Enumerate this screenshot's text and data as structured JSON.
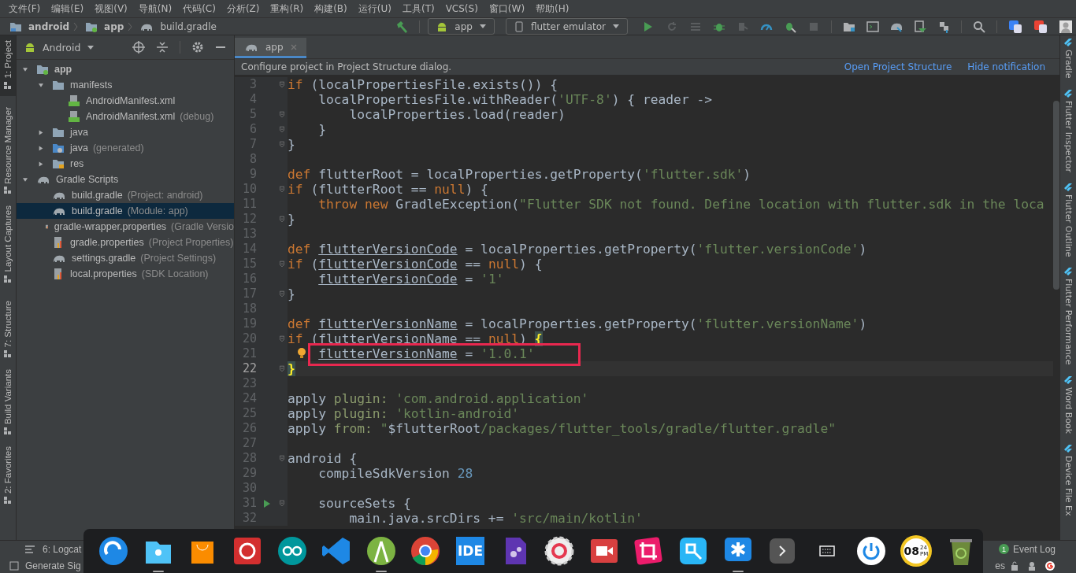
{
  "menu": [
    "文件(F)",
    "编辑(E)",
    "视图(V)",
    "导航(N)",
    "代码(C)",
    "分析(Z)",
    "重构(R)",
    "构建(B)",
    "运行(U)",
    "工具(T)",
    "VCS(S)",
    "窗口(W)",
    "帮助(H)"
  ],
  "breadcrumb": [
    {
      "label": "android",
      "kind": "project"
    },
    {
      "label": "app",
      "kind": "module"
    },
    {
      "label": "build.gradle",
      "kind": "gradle"
    }
  ],
  "toolbar": {
    "run_config": "app",
    "device": "flutter emulator"
  },
  "left_stripe": [
    {
      "label": "1: Project",
      "selected": true
    },
    {
      "label": "Resource Manager",
      "selected": false
    },
    {
      "label": "Layout Captures",
      "selected": false
    },
    {
      "label": "7: Structure",
      "selected": false
    },
    {
      "label": "Build Variants",
      "selected": false
    },
    {
      "label": "2: Favorites",
      "selected": false
    }
  ],
  "project": {
    "view": "Android",
    "tree": [
      {
        "label": "app",
        "kind": "module",
        "expanded": true,
        "selected": false,
        "children": [
          {
            "label": "manifests",
            "kind": "folder",
            "expanded": true,
            "selected": false,
            "children": [
              {
                "label": "AndroidManifest.xml",
                "kind": "manifest",
                "selected": false
              },
              {
                "label": "AndroidManifest.xml",
                "hint": "(debug)",
                "kind": "manifest",
                "selected": false
              }
            ]
          },
          {
            "label": "java",
            "kind": "folder",
            "expanded": false,
            "selected": false
          },
          {
            "label": "java",
            "hint": "(generated)",
            "kind": "genfolder",
            "expanded": false,
            "selected": false
          },
          {
            "label": "res",
            "kind": "resfolder",
            "expanded": false,
            "selected": false
          }
        ]
      },
      {
        "label": "Gradle Scripts",
        "kind": "gradle",
        "expanded": true,
        "selected": false,
        "children": [
          {
            "label": "build.gradle",
            "hint": "(Project: android)",
            "kind": "gradle",
            "selected": false
          },
          {
            "label": "build.gradle",
            "hint": "(Module: app)",
            "kind": "gradle",
            "selected": true
          },
          {
            "label": "gradle-wrapper.properties",
            "hint": "(Gradle Versio",
            "kind": "props",
            "selected": false
          },
          {
            "label": "gradle.properties",
            "hint": "(Project Properties)",
            "kind": "props",
            "selected": false
          },
          {
            "label": "settings.gradle",
            "hint": "(Project Settings)",
            "kind": "gradle",
            "selected": false
          },
          {
            "label": "local.properties",
            "hint": "(SDK Location)",
            "kind": "props",
            "selected": false
          }
        ]
      }
    ]
  },
  "editor_tabs": [
    {
      "label": "app",
      "selected": true
    }
  ],
  "notification": {
    "text": "Configure project in Project Structure dialog.",
    "links": [
      "Open Project Structure",
      "Hide notification"
    ]
  },
  "code": [
    {
      "number": "3",
      "fold": true,
      "current": false,
      "boxed": false,
      "lightbulb": false,
      "runnable": false,
      "tokens": [
        {
          "kind": "kw",
          "text": "if"
        },
        {
          "kind": "plain",
          "text": " (localPropertiesFile.exists()) {"
        }
      ]
    },
    {
      "number": "4",
      "fold": false,
      "current": false,
      "boxed": false,
      "lightbulb": false,
      "runnable": false,
      "tokens": [
        {
          "kind": "plain",
          "text": "    localPropertiesFile.withReader("
        },
        {
          "kind": "str",
          "text": "'UTF-8'"
        },
        {
          "kind": "plain",
          "text": ") { reader ->"
        }
      ]
    },
    {
      "number": "5",
      "fold": true,
      "current": false,
      "boxed": false,
      "lightbulb": false,
      "runnable": false,
      "tokens": [
        {
          "kind": "plain",
          "text": "        localProperties.load(reader)"
        }
      ]
    },
    {
      "number": "6",
      "fold": true,
      "current": false,
      "boxed": false,
      "lightbulb": false,
      "runnable": false,
      "tokens": [
        {
          "kind": "plain",
          "text": "    }"
        }
      ]
    },
    {
      "number": "7",
      "fold": true,
      "current": false,
      "boxed": false,
      "lightbulb": false,
      "runnable": false,
      "tokens": [
        {
          "kind": "plain",
          "text": "}"
        }
      ]
    },
    {
      "number": "8",
      "fold": false,
      "current": false,
      "boxed": false,
      "lightbulb": false,
      "runnable": false
    },
    {
      "number": "9",
      "fold": false,
      "current": false,
      "boxed": false,
      "lightbulb": false,
      "runnable": false,
      "tokens": [
        {
          "kind": "kw",
          "text": "def"
        },
        {
          "kind": "plain",
          "text": " flutterRoot = localProperties.getProperty("
        },
        {
          "kind": "str",
          "text": "'flutter.sdk'"
        },
        {
          "kind": "plain",
          "text": ")"
        }
      ]
    },
    {
      "number": "10",
      "fold": true,
      "current": false,
      "boxed": false,
      "lightbulb": false,
      "runnable": false,
      "tokens": [
        {
          "kind": "kw",
          "text": "if"
        },
        {
          "kind": "plain",
          "text": " (flutterRoot == "
        },
        {
          "kind": "kw",
          "text": "null"
        },
        {
          "kind": "plain",
          "text": ") {"
        }
      ]
    },
    {
      "number": "11",
      "fold": false,
      "current": false,
      "boxed": false,
      "lightbulb": false,
      "runnable": false,
      "tokens": [
        {
          "kind": "kw",
          "text": "    throw new"
        },
        {
          "kind": "plain",
          "text": " GradleException("
        },
        {
          "kind": "str",
          "text": "\"Flutter SDK not found. Define location with flutter.sdk in the loca"
        }
      ]
    },
    {
      "number": "12",
      "fold": true,
      "current": false,
      "boxed": false,
      "lightbulb": false,
      "runnable": false,
      "tokens": [
        {
          "kind": "plain",
          "text": "}"
        }
      ]
    },
    {
      "number": "13",
      "fold": false,
      "current": false,
      "boxed": false,
      "lightbulb": false,
      "runnable": false
    },
    {
      "number": "14",
      "fold": false,
      "current": false,
      "boxed": false,
      "lightbulb": false,
      "runnable": false,
      "tokens": [
        {
          "kind": "kw",
          "text": "def "
        },
        {
          "kind": "under",
          "text": "flutterVersionCode"
        },
        {
          "kind": "plain",
          "text": " = localProperties.getProperty("
        },
        {
          "kind": "str",
          "text": "'flutter.versionCode'"
        },
        {
          "kind": "plain",
          "text": ")"
        }
      ]
    },
    {
      "number": "15",
      "fold": true,
      "current": false,
      "boxed": false,
      "lightbulb": false,
      "runnable": false,
      "tokens": [
        {
          "kind": "kw",
          "text": "if"
        },
        {
          "kind": "plain",
          "text": " ("
        },
        {
          "kind": "under",
          "text": "flutterVersionCode"
        },
        {
          "kind": "plain",
          "text": " == "
        },
        {
          "kind": "kw",
          "text": "null"
        },
        {
          "kind": "plain",
          "text": ") {"
        }
      ]
    },
    {
      "number": "16",
      "fold": false,
      "current": false,
      "boxed": false,
      "lightbulb": false,
      "runnable": false,
      "tokens": [
        {
          "kind": "under",
          "text": "    flutterVersionCode"
        },
        {
          "kind": "plain",
          "text": " = "
        },
        {
          "kind": "str",
          "text": "'1'"
        }
      ]
    },
    {
      "number": "17",
      "fold": true,
      "current": false,
      "boxed": false,
      "lightbulb": false,
      "runnable": false,
      "tokens": [
        {
          "kind": "plain",
          "text": "}"
        }
      ]
    },
    {
      "number": "18",
      "fold": false,
      "current": false,
      "boxed": false,
      "lightbulb": false,
      "runnable": false
    },
    {
      "number": "19",
      "fold": false,
      "current": false,
      "boxed": false,
      "lightbulb": false,
      "runnable": false,
      "tokens": [
        {
          "kind": "kw",
          "text": "def "
        },
        {
          "kind": "under",
          "text": "flutterVersionName"
        },
        {
          "kind": "plain",
          "text": " = localProperties.getProperty("
        },
        {
          "kind": "str",
          "text": "'flutter.versionName'"
        },
        {
          "kind": "plain",
          "text": ")"
        }
      ]
    },
    {
      "number": "20",
      "fold": true,
      "current": false,
      "boxed": false,
      "lightbulb": false,
      "runnable": false,
      "tokens": [
        {
          "kind": "kw",
          "text": "if"
        },
        {
          "kind": "plain",
          "text": " ("
        },
        {
          "kind": "under",
          "text": "flutterVersionName"
        },
        {
          "kind": "plain",
          "text": " == "
        },
        {
          "kind": "kw",
          "text": "null"
        },
        {
          "kind": "plain",
          "text": ") "
        },
        {
          "kind": "match",
          "text": "{"
        }
      ]
    },
    {
      "number": "21",
      "fold": false,
      "current": false,
      "boxed": true,
      "lightbulb": true,
      "runnable": false,
      "tokens": [
        {
          "kind": "under",
          "text": "    flutterVersionName"
        },
        {
          "kind": "plain",
          "text": " = "
        },
        {
          "kind": "str",
          "text": "'1.0.1'"
        }
      ]
    },
    {
      "number": "22",
      "fold": true,
      "current": true,
      "boxed": false,
      "lightbulb": false,
      "runnable": false,
      "tokens": [
        {
          "kind": "match",
          "text": "}"
        }
      ]
    },
    {
      "number": "23",
      "fold": false,
      "current": false,
      "boxed": false,
      "lightbulb": false,
      "runnable": false
    },
    {
      "number": "24",
      "fold": false,
      "current": false,
      "boxed": false,
      "lightbulb": false,
      "runnable": false,
      "tokens": [
        {
          "kind": "plain",
          "text": "apply "
        },
        {
          "kind": "named",
          "text": "plugin: "
        },
        {
          "kind": "str",
          "text": "'com.android.application'"
        }
      ]
    },
    {
      "number": "25",
      "fold": false,
      "current": false,
      "boxed": false,
      "lightbulb": false,
      "runnable": false,
      "tokens": [
        {
          "kind": "plain",
          "text": "apply "
        },
        {
          "kind": "named",
          "text": "plugin: "
        },
        {
          "kind": "str",
          "text": "'kotlin-android'"
        }
      ]
    },
    {
      "number": "26",
      "fold": false,
      "current": false,
      "boxed": false,
      "lightbulb": false,
      "runnable": false,
      "tokens": [
        {
          "kind": "plain",
          "text": "apply "
        },
        {
          "kind": "named",
          "text": "from: "
        },
        {
          "kind": "str",
          "text": "\""
        },
        {
          "kind": "plain",
          "text": "$flutterRoot"
        },
        {
          "kind": "str",
          "text": "/packages/flutter_tools/gradle/flutter.gradle\""
        }
      ]
    },
    {
      "number": "27",
      "fold": false,
      "current": false,
      "boxed": false,
      "lightbulb": false,
      "runnable": false
    },
    {
      "number": "28",
      "fold": true,
      "current": false,
      "boxed": false,
      "lightbulb": false,
      "runnable": false,
      "tokens": [
        {
          "kind": "plain",
          "text": "android {"
        }
      ]
    },
    {
      "number": "29",
      "fold": false,
      "current": false,
      "boxed": false,
      "lightbulb": false,
      "runnable": false,
      "tokens": [
        {
          "kind": "plain",
          "text": "    compileSdkVersion "
        },
        {
          "kind": "num",
          "text": "28"
        }
      ]
    },
    {
      "number": "30",
      "fold": false,
      "current": false,
      "boxed": false,
      "lightbulb": false,
      "runnable": false
    },
    {
      "number": "31",
      "fold": true,
      "current": false,
      "boxed": false,
      "lightbulb": false,
      "runnable": true,
      "tokens": [
        {
          "kind": "plain",
          "text": "    sourceSets {"
        }
      ]
    },
    {
      "number": "32",
      "fold": false,
      "current": false,
      "boxed": false,
      "lightbulb": false,
      "runnable": false,
      "tokens": [
        {
          "kind": "plain",
          "text": "        main.java.srcDirs += "
        },
        {
          "kind": "str",
          "text": "'src/main/kotlin'"
        }
      ]
    }
  ],
  "right_stripe": [
    "Gradle",
    "Flutter Inspector",
    "Flutter Outline",
    "Flutter Performance",
    "Word Book",
    "Device File Ex"
  ],
  "status": {
    "logcat": "6: Logcat",
    "generate": "Generate Sig",
    "event_log": "Event Log",
    "event_count": "1",
    "cut_text": "es"
  },
  "dock": [
    {
      "kind": "launcher",
      "running": false
    },
    {
      "kind": "files",
      "running": true
    },
    {
      "kind": "store",
      "running": false
    },
    {
      "kind": "music",
      "running": false
    },
    {
      "kind": "arduino",
      "running": false
    },
    {
      "kind": "vscode",
      "running": false
    },
    {
      "kind": "studio",
      "running": true
    },
    {
      "kind": "chrome",
      "running": false
    },
    {
      "kind": "ide",
      "label": "IDE",
      "running": false
    },
    {
      "kind": "gears",
      "running": false
    },
    {
      "kind": "settings",
      "running": false
    },
    {
      "kind": "recorder",
      "running": false
    },
    {
      "kind": "crop",
      "running": false
    },
    {
      "kind": "translator",
      "running": false
    },
    {
      "kind": "chat",
      "running": true
    },
    {
      "kind": "more",
      "running": false
    },
    {
      "kind": "keyboard",
      "running": false
    },
    {
      "kind": "power",
      "running": false
    },
    {
      "kind": "clock",
      "label": "08",
      "sub": "24",
      "sub2": "PM",
      "running": false
    },
    {
      "kind": "trash",
      "running": false
    }
  ]
}
